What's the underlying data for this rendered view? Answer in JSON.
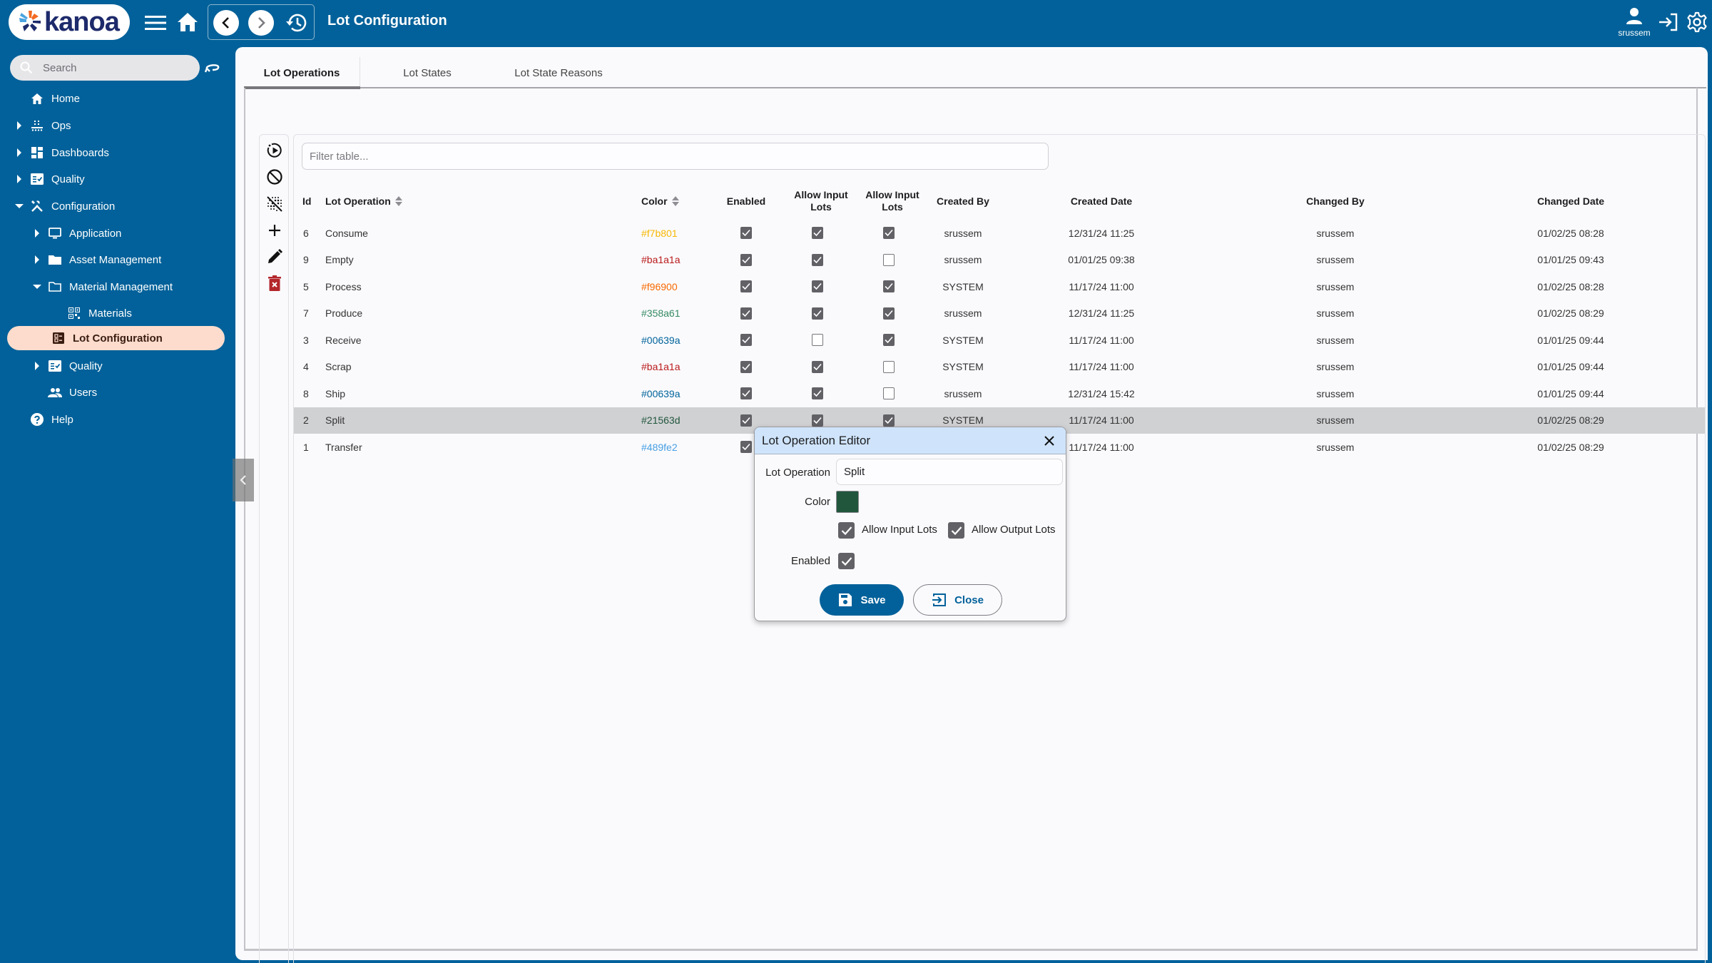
{
  "header": {
    "logo_text": "kanoa",
    "page_title": "Lot Configuration",
    "user": "srussem",
    "icons": [
      "menu-icon",
      "home-icon",
      "back-icon",
      "forward-icon",
      "history-icon",
      "user-icon",
      "logout-icon",
      "settings-icon"
    ]
  },
  "sidebar": {
    "search_placeholder": "Search",
    "items": [
      {
        "label": "Home",
        "icon": "home-icon",
        "level": 0,
        "caret": "none"
      },
      {
        "label": "Ops",
        "icon": "conveyor-icon",
        "level": 0,
        "caret": "collapsed"
      },
      {
        "label": "Dashboards",
        "icon": "dashboard-icon",
        "level": 0,
        "caret": "collapsed"
      },
      {
        "label": "Quality",
        "icon": "checklist-icon",
        "level": 0,
        "caret": "collapsed"
      },
      {
        "label": "Configuration",
        "icon": "tools-icon",
        "level": 0,
        "caret": "expanded"
      },
      {
        "label": "Application",
        "icon": "monitor-icon",
        "level": 1,
        "caret": "collapsed"
      },
      {
        "label": "Asset Management",
        "icon": "folder-icon",
        "level": 1,
        "caret": "collapsed"
      },
      {
        "label": "Material Management",
        "icon": "folder-open-icon",
        "level": 1,
        "caret": "expanded"
      },
      {
        "label": "Materials",
        "icon": "qr-code-icon",
        "level": 2,
        "caret": "none"
      },
      {
        "label": "Lot Configuration",
        "icon": "list-alt-icon",
        "level": 2,
        "caret": "none",
        "active": true
      },
      {
        "label": "Quality",
        "icon": "checklist-icon",
        "level": 1,
        "caret": "collapsed"
      },
      {
        "label": "Users",
        "icon": "people-icon",
        "level": 1,
        "caret": "none"
      },
      {
        "label": "Help",
        "icon": "help-icon",
        "level": 0,
        "caret": "none"
      }
    ]
  },
  "tabs": [
    {
      "label": "Lot Operations",
      "active": true
    },
    {
      "label": "Lot States",
      "active": false
    },
    {
      "label": "Lot State Reasons",
      "active": false
    }
  ],
  "toolbar": {
    "tools": [
      "activate-icon",
      "deactivate-icon",
      "clear-filter-icon",
      "add-icon",
      "edit-icon",
      "delete-icon"
    ]
  },
  "table": {
    "filter_placeholder": "Filter table...",
    "filter_value": "",
    "columns": [
      "Id",
      "Lot Operation",
      "Color",
      "Enabled",
      "Allow Input Lots",
      "Allow Input Lots",
      "Created By",
      "Created Date",
      "Changed By",
      "Changed Date"
    ],
    "rows": [
      {
        "id": "6",
        "name": "Consume",
        "color": "#f7b801",
        "enabled": true,
        "allow_input": true,
        "allow_output": true,
        "created_by": "srussem",
        "created_date": "12/31/24 11:25",
        "changed_by": "srussem",
        "changed_date": "01/02/25 08:28"
      },
      {
        "id": "9",
        "name": "Empty",
        "color": "#ba1a1a",
        "enabled": true,
        "allow_input": true,
        "allow_output": false,
        "created_by": "srussem",
        "created_date": "01/01/25 09:38",
        "changed_by": "srussem",
        "changed_date": "01/01/25 09:43"
      },
      {
        "id": "5",
        "name": "Process",
        "color": "#f96900",
        "enabled": true,
        "allow_input": true,
        "allow_output": true,
        "created_by": "SYSTEM",
        "created_date": "11/17/24 11:00",
        "changed_by": "srussem",
        "changed_date": "01/02/25 08:28"
      },
      {
        "id": "7",
        "name": "Produce",
        "color": "#358a61",
        "enabled": true,
        "allow_input": true,
        "allow_output": true,
        "created_by": "srussem",
        "created_date": "12/31/24 11:25",
        "changed_by": "srussem",
        "changed_date": "01/02/25 08:29"
      },
      {
        "id": "3",
        "name": "Receive",
        "color": "#00639a",
        "enabled": true,
        "allow_input": false,
        "allow_output": true,
        "created_by": "SYSTEM",
        "created_date": "11/17/24 11:00",
        "changed_by": "srussem",
        "changed_date": "01/01/25 09:44"
      },
      {
        "id": "4",
        "name": "Scrap",
        "color": "#ba1a1a",
        "enabled": true,
        "allow_input": true,
        "allow_output": false,
        "created_by": "SYSTEM",
        "created_date": "11/17/24 11:00",
        "changed_by": "srussem",
        "changed_date": "01/01/25 09:44"
      },
      {
        "id": "8",
        "name": "Ship",
        "color": "#00639a",
        "enabled": true,
        "allow_input": true,
        "allow_output": false,
        "created_by": "srussem",
        "created_date": "12/31/24 15:42",
        "changed_by": "srussem",
        "changed_date": "01/01/25 09:44"
      },
      {
        "id": "2",
        "name": "Split",
        "color": "#21563d",
        "enabled": true,
        "allow_input": true,
        "allow_output": true,
        "created_by": "SYSTEM",
        "created_date": "11/17/24 11:00",
        "changed_by": "srussem",
        "changed_date": "01/02/25 08:29",
        "selected": true
      },
      {
        "id": "1",
        "name": "Transfer",
        "color": "#489fe2",
        "enabled": true,
        "allow_input": true,
        "allow_output": true,
        "created_by": "SYSTEM",
        "created_date": "11/17/24 11:00",
        "changed_by": "srussem",
        "changed_date": "01/02/25 08:29"
      }
    ]
  },
  "dialog": {
    "title": "Lot Operation Editor",
    "lot_operation_label": "Lot Operation",
    "lot_operation_value": "Split",
    "color_label": "Color",
    "color_value": "#21563d",
    "allow_input_label": "Allow Input Lots",
    "allow_input": true,
    "allow_output_label": "Allow Output Lots",
    "allow_output": true,
    "enabled_label": "Enabled",
    "enabled": true,
    "save_label": "Save",
    "close_label": "Close"
  },
  "colors": {
    "brand": "#02619a",
    "active_nav": "#fddccd",
    "dialog_header": "#cfe4fb",
    "selected_row": "#d0d1d3",
    "delete": "#b3262b"
  }
}
